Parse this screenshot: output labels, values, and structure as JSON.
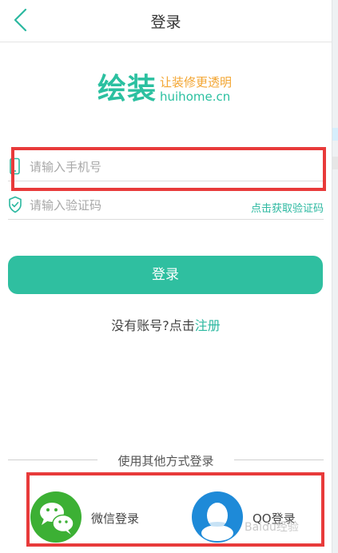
{
  "header": {
    "title": "登录"
  },
  "logo": {
    "name": "绘装",
    "slogan": "让装修更透明",
    "domain": "huihome.cn"
  },
  "form": {
    "phone_placeholder": "请输入手机号",
    "code_placeholder": "请输入验证码",
    "get_code_label": "点击获取验证码"
  },
  "login_button": "登录",
  "register": {
    "prompt": "没有账号?点击",
    "link": "注册"
  },
  "other_login": {
    "label": "使用其他方式登录",
    "wechat_label": "微信登录",
    "qq_label": "QQ登录"
  },
  "watermark": "Baidu经验",
  "colors": {
    "accent": "#2fbfa0",
    "annotation": "#e83a3a",
    "wechat": "#3cb034",
    "qq": "#1e8ad8"
  }
}
